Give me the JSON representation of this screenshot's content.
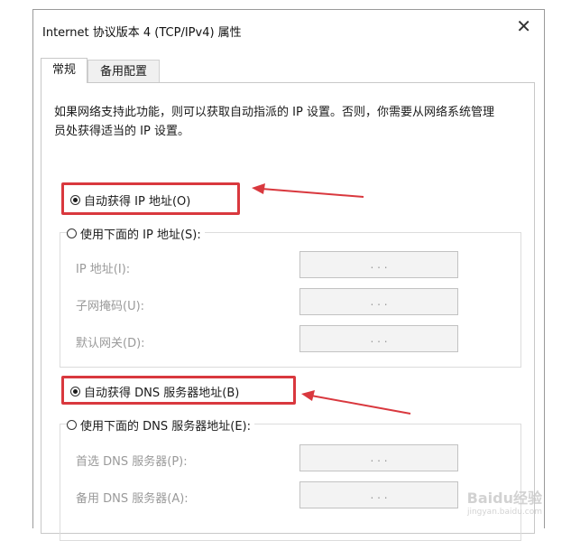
{
  "window": {
    "title": "Internet 协议版本 4 (TCP/IPv4) 属性",
    "close_glyph": "✕"
  },
  "tabs": [
    {
      "label": "常规",
      "active": true
    },
    {
      "label": "备用配置",
      "active": false
    }
  ],
  "description": "如果网络支持此功能，则可以获取自动指派的 IP 设置。否则，你需要从网络系统管理员处获得适当的 IP 设置。",
  "ip_section": {
    "auto_label": "自动获得 IP 地址(O)",
    "auto_selected": true,
    "manual_label": "使用下面的 IP 地址(S):",
    "fields": [
      {
        "label": "IP 地址(I):",
        "value": ".      .      ."
      },
      {
        "label": "子网掩码(U):",
        "value": ".      .      ."
      },
      {
        "label": "默认网关(D):",
        "value": ".      .      ."
      }
    ]
  },
  "dns_section": {
    "auto_label": "自动获得 DNS 服务器地址(B)",
    "auto_selected": true,
    "manual_label": "使用下面的 DNS 服务器地址(E):",
    "fields": [
      {
        "label": "首选 DNS 服务器(P):",
        "value": ".      .      ."
      },
      {
        "label": "备用 DNS 服务器(A):",
        "value": ".      .      ."
      }
    ]
  },
  "watermark": {
    "brand": "Baidu经验",
    "url": "jingyan.baidu.com"
  },
  "colors": {
    "highlight": "#d9383e",
    "arrow": "#d9383e"
  }
}
